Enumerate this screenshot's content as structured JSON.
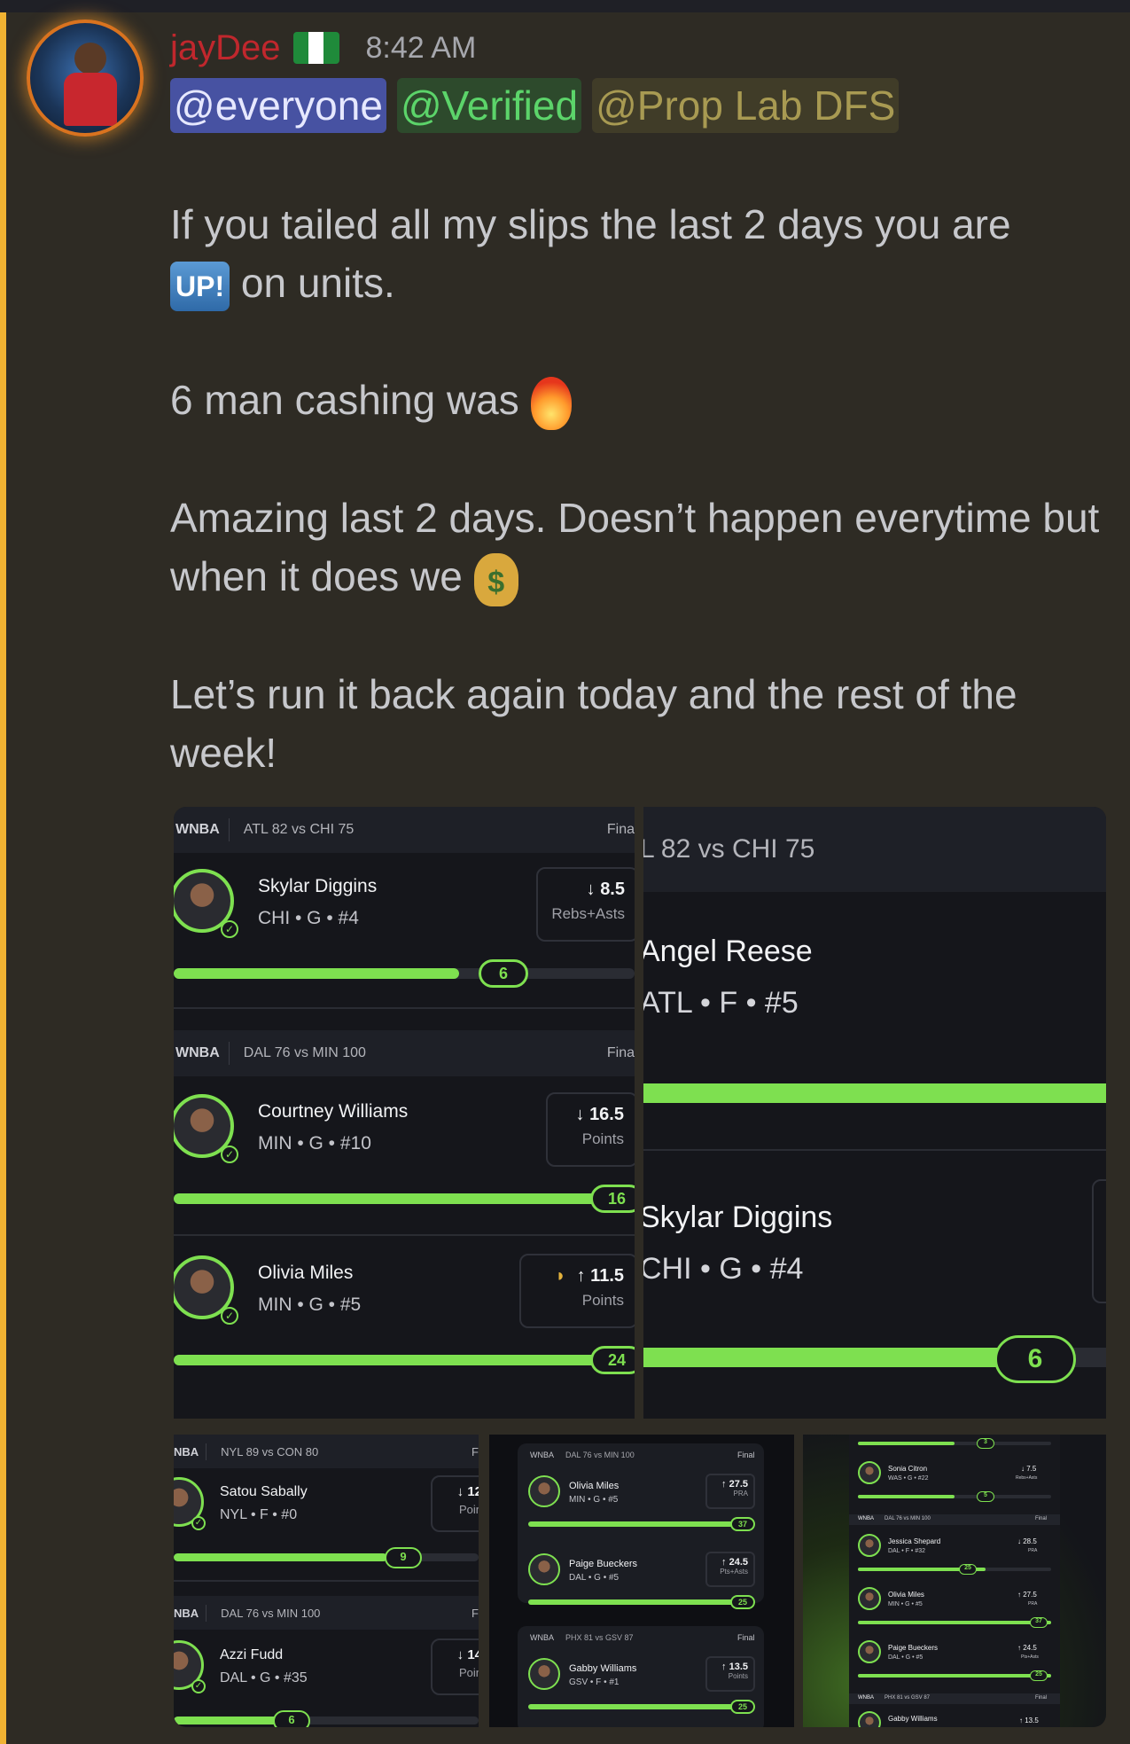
{
  "message": {
    "username": "jayDee",
    "flag_colors": [
      "#1f8a3a",
      "#ffffff",
      "#1f8a3a"
    ],
    "timestamp": "8:42 AM",
    "mentions": [
      "@everyone",
      "@Verified",
      "@Prop Lab DFS"
    ],
    "line1": "If you tailed all my slips the last 2 days you are",
    "up_emoji": "UP!",
    "line2": "on units.",
    "line3": "6 man cashing was",
    "line4": "Amazing last 2 days. Doesn’t happen everytime but when it does we",
    "moneybag_symbol": "$",
    "line5": "Let’s run it back again today and the rest of the week!"
  },
  "shot1": {
    "game1": "ATL 82 vs CHI 75",
    "league": "WNBA",
    "final": "Fina",
    "p1": {
      "name": "Skylar Diggins",
      "meta": "CHI • G • #4",
      "line": "8.5",
      "stat": "Rebs+Asts",
      "dir": "↓",
      "result": "6",
      "progress": 0.7
    },
    "game2": "DAL 76 vs MIN 100",
    "p2": {
      "name": "Courtney Williams",
      "meta": "MIN • G • #10",
      "line": "16.5",
      "stat": "Points",
      "dir": "↓",
      "result": "16",
      "progress": 0.97
    },
    "p3": {
      "name": "Olivia Miles",
      "meta": "MIN • G • #5",
      "line": "11.5",
      "stat": "Points",
      "dir": "↑",
      "result": "24",
      "progress": 0.97
    }
  },
  "shot2": {
    "game": "L 82 vs CHI 75",
    "p1": {
      "name": "Angel Reese",
      "meta": "ATL • F • #5",
      "progress": 1.0
    },
    "p2": {
      "name": "Skylar Diggins",
      "meta": "CHI • G • #4",
      "result": "6",
      "progress": 0.84
    }
  },
  "shot3": {
    "league": "NBA",
    "game1": "NYL 89 vs CON 80",
    "final": "F",
    "p1": {
      "name": "Satou Sabally",
      "meta": "NYL • F • #0",
      "line": "12",
      "stat": "Poin",
      "dir": "↓",
      "result": "9",
      "progress": 0.75
    },
    "game2": "DAL 76 vs MIN 100",
    "p2": {
      "name": "Azzi Fudd",
      "meta": "DAL • G • #35",
      "line": "14",
      "stat": "Poin",
      "dir": "↓",
      "result": "6",
      "progress": 0.4
    }
  },
  "shot4": {
    "league": "WNBA",
    "final": "Final",
    "game1": "DAL 76 vs MIN 100",
    "p1": {
      "name": "Olivia Miles",
      "meta": "MIN • G • #5",
      "line": "27.5",
      "stat": "PRA",
      "dir": "↑",
      "result": "37",
      "progress": 0.95
    },
    "p2": {
      "name": "Paige Bueckers",
      "meta": "DAL • G • #5",
      "line": "24.5",
      "stat": "Pts+Asts",
      "dir": "↑",
      "result": "25",
      "progress": 0.95
    },
    "game2": "PHX 81 vs GSV 87",
    "p3": {
      "name": "Gabby Williams",
      "meta": "GSV • F • #1",
      "line": "13.5",
      "stat": "Points",
      "dir": "↑",
      "result": "25",
      "progress": 0.95
    }
  },
  "shot5": {
    "r0": {
      "result": "3"
    },
    "p1": {
      "name": "Sonia Citron",
      "meta": "WAS • G • #22",
      "line": "7.5",
      "stat": "Rebs+Asts",
      "dir": "↓",
      "result": "5"
    },
    "league": "WNBA",
    "final": "Final",
    "game1": "DAL 76 vs MIN 100",
    "p2": {
      "name": "Jessica Shepard",
      "meta": "DAL • F • #32",
      "line": "28.5",
      "stat": "PRA",
      "dir": "↓",
      "result": "25"
    },
    "p3": {
      "name": "Olivia Miles",
      "meta": "MIN • G • #5",
      "line": "27.5",
      "stat": "PRA",
      "dir": "↑",
      "result": "37"
    },
    "p4": {
      "name": "Paige Bueckers",
      "meta": "DAL • G • #5",
      "line": "24.5",
      "stat": "Pts+Asts",
      "dir": "↑",
      "result": "25"
    },
    "game2": "PHX 81 vs GSV 87",
    "p5": {
      "name": "Gabby Williams",
      "line": "13.5",
      "dir": "↑"
    }
  }
}
